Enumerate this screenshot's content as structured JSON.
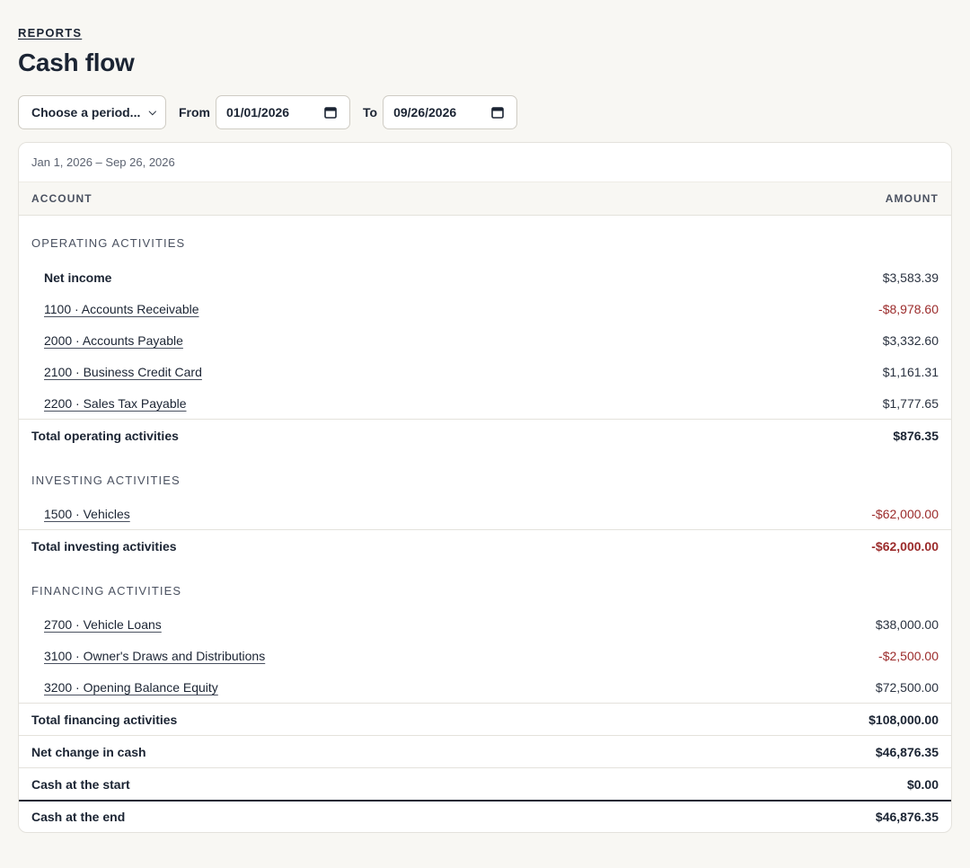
{
  "header": {
    "eyebrow": "REPORTS",
    "title": "Cash flow"
  },
  "controls": {
    "period_select": "Choose a period...",
    "from_label": "From",
    "from_value": "01/01/2026",
    "to_label": "To",
    "to_value": "09/26/2026"
  },
  "report": {
    "range": "Jan 1, 2026 – Sep 26, 2026",
    "columns": {
      "account": "ACCOUNT",
      "amount": "AMOUNT"
    },
    "operating": {
      "title": "OPERATING ACTIVITIES",
      "net_income": {
        "label": "Net income",
        "amount": "$3,583.39"
      },
      "items": [
        {
          "label": "1100 · Accounts Receivable",
          "amount": "-$8,978.60"
        },
        {
          "label": "2000 · Accounts Payable",
          "amount": "$3,332.60"
        },
        {
          "label": "2100 · Business Credit Card",
          "amount": "$1,161.31"
        },
        {
          "label": "2200 · Sales Tax Payable",
          "amount": "$1,777.65"
        }
      ],
      "total": {
        "label": "Total operating activities",
        "amount": "$876.35"
      }
    },
    "investing": {
      "title": "INVESTING ACTIVITIES",
      "items": [
        {
          "label": "1500 · Vehicles",
          "amount": "-$62,000.00"
        }
      ],
      "total": {
        "label": "Total investing activities",
        "amount": "-$62,000.00"
      }
    },
    "financing": {
      "title": "FINANCING ACTIVITIES",
      "items": [
        {
          "label": "2700 · Vehicle Loans",
          "amount": "$38,000.00"
        },
        {
          "label": "3100 · Owner's Draws and Distributions",
          "amount": "-$2,500.00"
        },
        {
          "label": "3200 · Opening Balance Equity",
          "amount": "$72,500.00"
        }
      ],
      "total": {
        "label": "Total financing activities",
        "amount": "$108,000.00"
      }
    },
    "summary": {
      "net_change": {
        "label": "Net change in cash",
        "amount": "$46,876.35"
      },
      "cash_start": {
        "label": "Cash at the start",
        "amount": "$0.00"
      },
      "cash_end": {
        "label": "Cash at the end",
        "amount": "$46,876.35"
      }
    }
  },
  "colors": {
    "background": "#f8f7f3",
    "text": "#1b2433",
    "negative": "#9b2b2b"
  },
  "icons": {
    "period_select": "chevron-down-icon",
    "date_picker": "calendar-icon"
  }
}
